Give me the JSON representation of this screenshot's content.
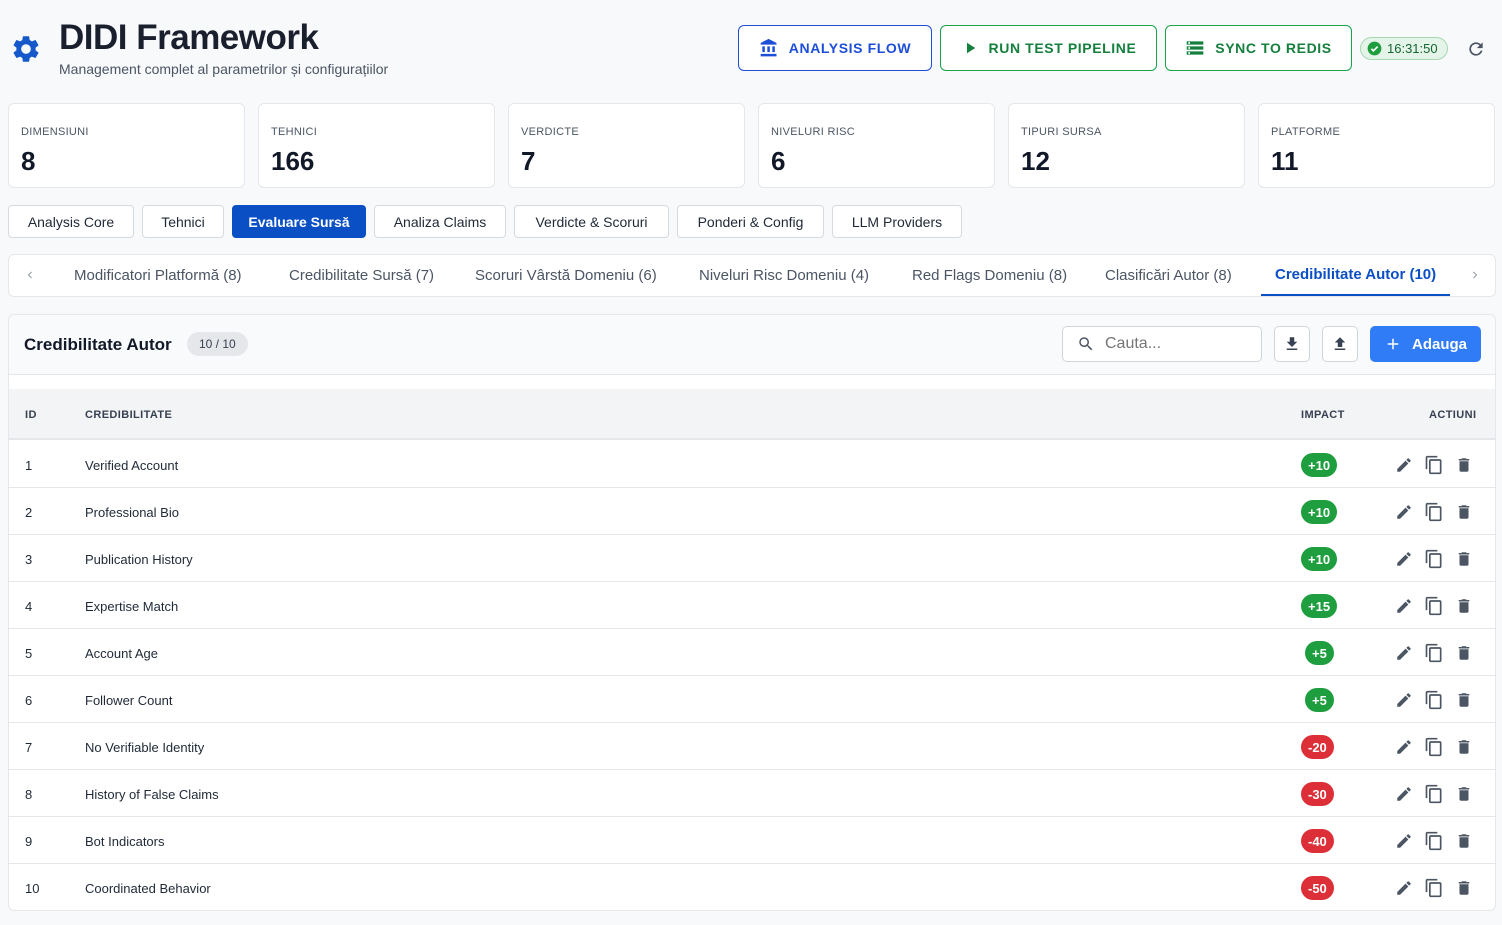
{
  "header": {
    "title": "DIDI Framework",
    "subtitle": "Management complet al parametrilor și configurațiilor",
    "buttons": [
      {
        "label": "ANALYSIS FLOW",
        "icon": "bank-icon"
      },
      {
        "label": "RUN TEST PIPELINE",
        "icon": "play-icon"
      },
      {
        "label": "SYNC TO REDIS",
        "icon": "storage-icon"
      }
    ],
    "clock": "16:31:50",
    "clock_icon": "check-circle-icon",
    "refresh_icon": "refresh-icon"
  },
  "stats": [
    {
      "label": "DIMENSIUNI",
      "value": "8"
    },
    {
      "label": "TEHNICI",
      "value": "166"
    },
    {
      "label": "VERDICTE",
      "value": "7"
    },
    {
      "label": "NIVELURI RISC",
      "value": "6"
    },
    {
      "label": "TIPURI SURSA",
      "value": "12"
    },
    {
      "label": "PLATFORME",
      "value": "11"
    }
  ],
  "categories": [
    {
      "label": "Analysis Core",
      "active": false
    },
    {
      "label": "Tehnici",
      "active": false
    },
    {
      "label": "Evaluare Sursă",
      "active": true
    },
    {
      "label": "Analiza Claims",
      "active": false
    },
    {
      "label": "Verdicte & Scoruri",
      "active": false
    },
    {
      "label": "Ponderi & Config",
      "active": false
    },
    {
      "label": "LLM Providers",
      "active": false
    }
  ],
  "subtabs": [
    {
      "label": "Modificatori Platformă (8)",
      "active": false
    },
    {
      "label": "Credibilitate Sursă (7)",
      "active": false
    },
    {
      "label": "Scoruri Vârstă Domeniu (6)",
      "active": false
    },
    {
      "label": "Niveluri Risc Domeniu (4)",
      "active": false
    },
    {
      "label": "Red Flags Domeniu (8)",
      "active": false
    },
    {
      "label": "Clasificări Autor (8)",
      "active": false
    },
    {
      "label": "Credibilitate Autor (10)",
      "active": true
    }
  ],
  "panel": {
    "title": "Credibilitate Autor",
    "count": "10 / 10",
    "search_placeholder": "Cauta...",
    "add_label": "Adauga",
    "columns": {
      "id": "ID",
      "name": "CREDIBILITATE",
      "impact": "IMPACT",
      "actions": "ACTIUNI"
    },
    "rows": [
      {
        "id": "1",
        "name": "Verified Account",
        "impact": "+10"
      },
      {
        "id": "2",
        "name": "Professional Bio",
        "impact": "+10"
      },
      {
        "id": "3",
        "name": "Publication History",
        "impact": "+10"
      },
      {
        "id": "4",
        "name": "Expertise Match",
        "impact": "+15"
      },
      {
        "id": "5",
        "name": "Account Age",
        "impact": "+5"
      },
      {
        "id": "6",
        "name": "Follower Count",
        "impact": "+5"
      },
      {
        "id": "7",
        "name": "No Verifiable Identity",
        "impact": "-20"
      },
      {
        "id": "8",
        "name": "History of False Claims",
        "impact": "-30"
      },
      {
        "id": "9",
        "name": "Bot Indicators",
        "impact": "-40"
      },
      {
        "id": "10",
        "name": "Coordinated Behavior",
        "impact": "-50"
      }
    ]
  },
  "colors": {
    "primary": "#0b4fc4",
    "positive": "#1e9e3e",
    "negative": "#dc2f38",
    "success": "#15803d"
  }
}
